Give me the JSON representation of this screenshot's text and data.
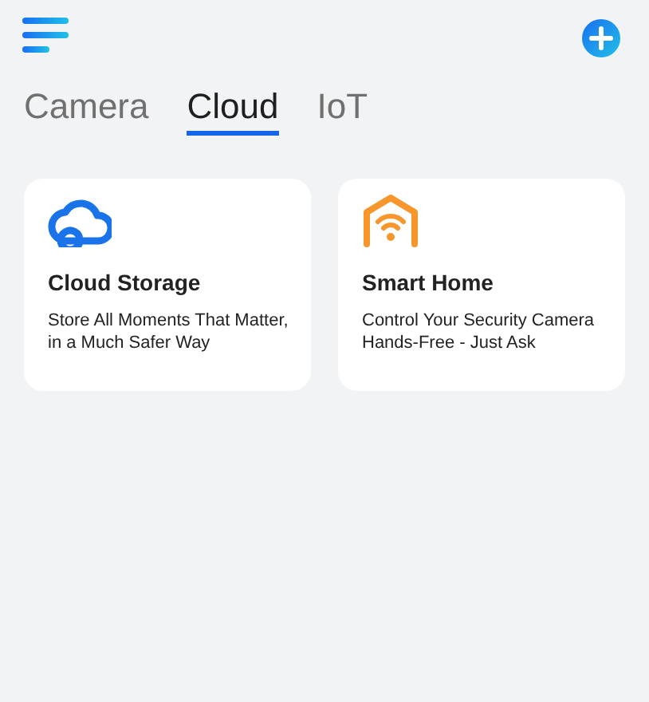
{
  "tabs": [
    {
      "label": "Camera",
      "selected": false
    },
    {
      "label": "Cloud",
      "selected": true
    },
    {
      "label": "IoT",
      "selected": false
    }
  ],
  "cards": [
    {
      "kind": "cloud",
      "title": "Cloud Storage",
      "description": "Store All Moments That Matter, in a Much Safer Way"
    },
    {
      "kind": "home",
      "title": "Smart Home",
      "description": "Control Your Security Camera Hands-Free - Just Ask"
    }
  ]
}
